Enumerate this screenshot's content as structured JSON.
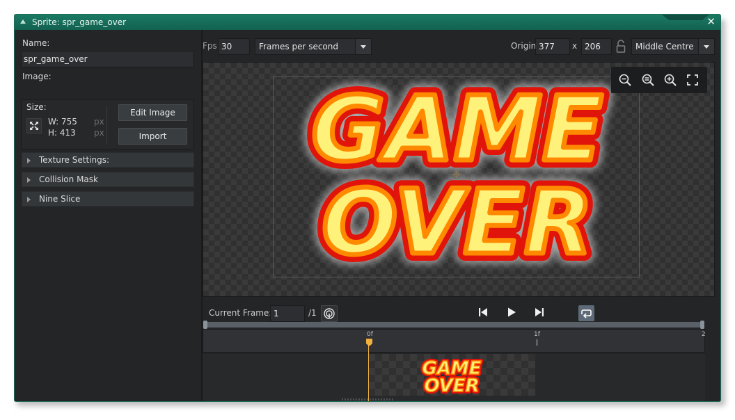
{
  "window": {
    "title": "Sprite: spr_game_over",
    "close_glyph": "✕"
  },
  "left": {
    "name_label": "Name:",
    "name_value": "spr_game_over",
    "image_label": "Image:",
    "size_label": "Size:",
    "width_text": "W: 755",
    "height_text": "H: 413",
    "unit_w": "px",
    "unit_h": "px",
    "edit_image": "Edit Image",
    "import": "Import",
    "sections": [
      "Texture Settings:",
      "Collision Mask",
      "Nine Slice"
    ]
  },
  "toolbar": {
    "fps_label": "Fps",
    "fps_value": "30",
    "speed_mode": "Frames per second",
    "origin_label": "Origin",
    "origin_x": "377",
    "x_sep": "x",
    "origin_y": "206",
    "origin_mode": "Middle Centre"
  },
  "sprite": {
    "line1": "GAME",
    "line2": "OVER",
    "colors": {
      "fill": "#fff27a",
      "glow": "#ff8a00",
      "outline": "#e0140b"
    }
  },
  "playback": {
    "current_frame_label": "Current Frame:",
    "current_frame_value": "1",
    "frame_total": "/1"
  },
  "timeline": {
    "ticks": [
      "0f",
      "1f",
      "2"
    ]
  },
  "colors": {
    "accent": "#1a7a63",
    "background": "#232527",
    "playhead": "#f0b040"
  }
}
